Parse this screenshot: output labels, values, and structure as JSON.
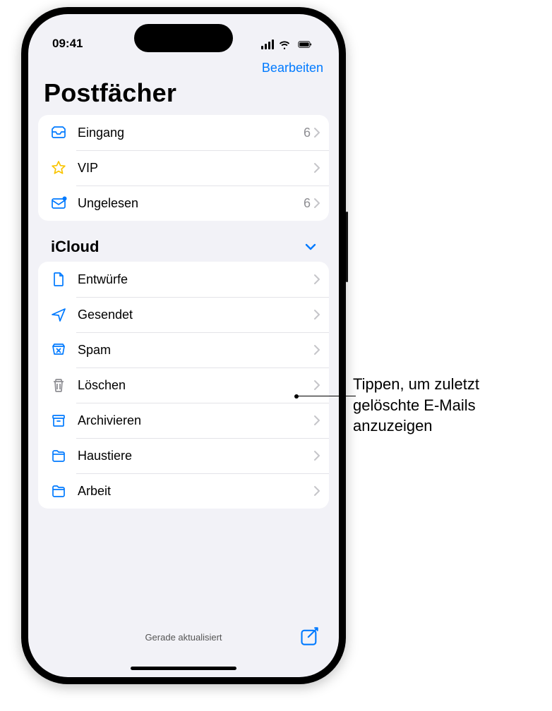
{
  "status": {
    "time": "09:41"
  },
  "nav": {
    "edit": "Bearbeiten"
  },
  "title": "Postfächer",
  "favorites": [
    {
      "icon": "inbox",
      "label": "Eingang",
      "count": "6"
    },
    {
      "icon": "star",
      "label": "VIP",
      "count": ""
    },
    {
      "icon": "unread",
      "label": "Ungelesen",
      "count": "6"
    }
  ],
  "section": {
    "title": "iCloud"
  },
  "folders": [
    {
      "icon": "draft",
      "label": "Entwürfe"
    },
    {
      "icon": "sent",
      "label": "Gesendet"
    },
    {
      "icon": "spam",
      "label": "Spam"
    },
    {
      "icon": "trash",
      "label": "Löschen"
    },
    {
      "icon": "archive",
      "label": "Archivieren"
    },
    {
      "icon": "folder",
      "label": "Haustiere"
    },
    {
      "icon": "folder",
      "label": "Arbeit"
    }
  ],
  "toolbar": {
    "status": "Gerade aktualisiert"
  },
  "callout": {
    "text": "Tippen, um zuletzt gelöschte E-Mails anzuzeigen"
  }
}
